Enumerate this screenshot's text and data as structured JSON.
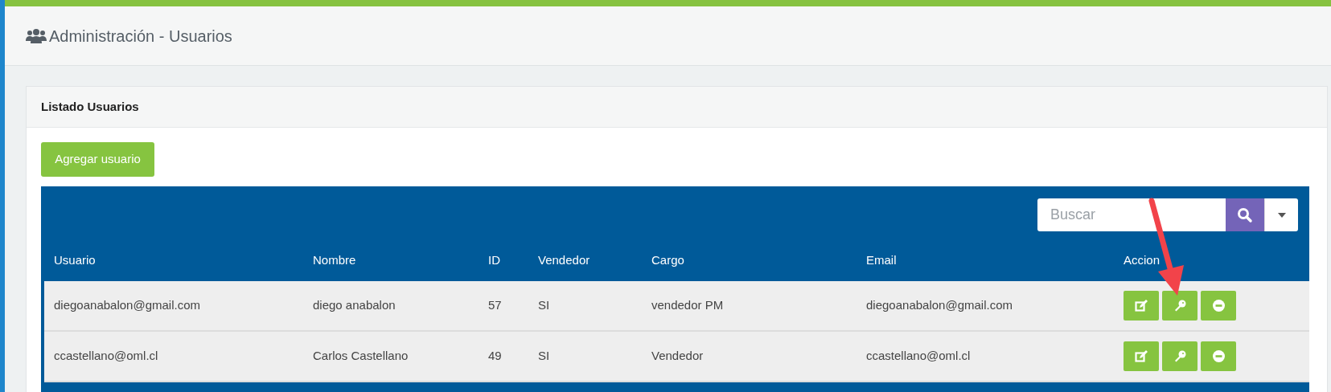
{
  "page": {
    "title": "Administración - Usuarios"
  },
  "card": {
    "title": "Listado Usuarios",
    "add_button": "Agregar usuario"
  },
  "search": {
    "placeholder": "Buscar"
  },
  "table": {
    "columns": [
      "Usuario",
      "Nombre",
      "ID",
      "Vendedor",
      "Cargo",
      "Email",
      "Accion"
    ],
    "rows": [
      {
        "cells": [
          "diegoanabalon@gmail.com",
          "diego anabalon",
          "57",
          "SI",
          "vendedor PM",
          "diegoanabalon@gmail.com"
        ],
        "actions": [
          {
            "kind": "edit"
          },
          {
            "kind": "key"
          },
          {
            "kind": "remove"
          }
        ]
      },
      {
        "cells": [
          "ccastellano@oml.cl",
          "Carlos Castellano",
          "49",
          "SI",
          "Vendedor",
          "ccastellano@oml.cl"
        ],
        "actions": [
          {
            "kind": "edit"
          },
          {
            "kind": "key"
          },
          {
            "kind": "remove"
          }
        ]
      }
    ]
  }
}
